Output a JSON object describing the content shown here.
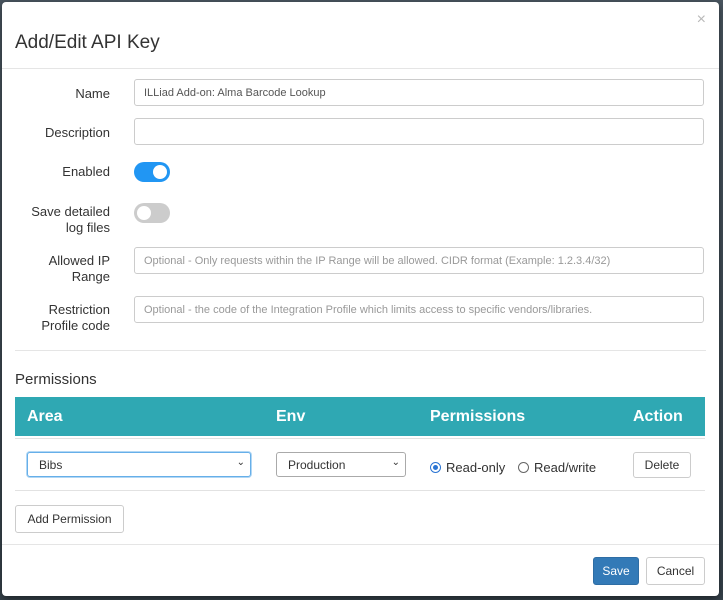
{
  "modal": {
    "title": "Add/Edit API Key",
    "close_glyph": "×"
  },
  "form": {
    "name_label": "Name",
    "name_value": "ILLiad Add-on: Alma Barcode Lookup",
    "description_label": "Description",
    "description_value": "",
    "enabled_label": "Enabled",
    "enabled": true,
    "save_log_label_line1": "Save detailed",
    "save_log_label_line2": "log files",
    "save_log_enabled": false,
    "ip_range_label_line1": "Allowed IP",
    "ip_range_label_line2": "Range",
    "ip_range_placeholder": "Optional - Only requests within the IP Range will be allowed. CIDR format (Example: 1.2.3.4/32)",
    "restriction_label_line1": "Restriction",
    "restriction_label_line2": "Profile code",
    "restriction_placeholder": "Optional - the code of the Integration Profile which limits access to specific vendors/libraries."
  },
  "permissions": {
    "section_title": "Permissions",
    "columns": [
      "Area",
      "Env",
      "Permissions",
      "Action"
    ],
    "rows": [
      {
        "area": "Bibs",
        "env": "Production",
        "options": [
          "Read-only",
          "Read/write"
        ],
        "selected": "Read-only",
        "action_label": "Delete"
      }
    ],
    "add_button_label": "Add Permission"
  },
  "footer": {
    "save_label": "Save",
    "cancel_label": "Cancel"
  },
  "colors": {
    "table_header": "#2fa8b3",
    "toggle_on": "#2196f3",
    "primary_button": "#337ab7"
  }
}
